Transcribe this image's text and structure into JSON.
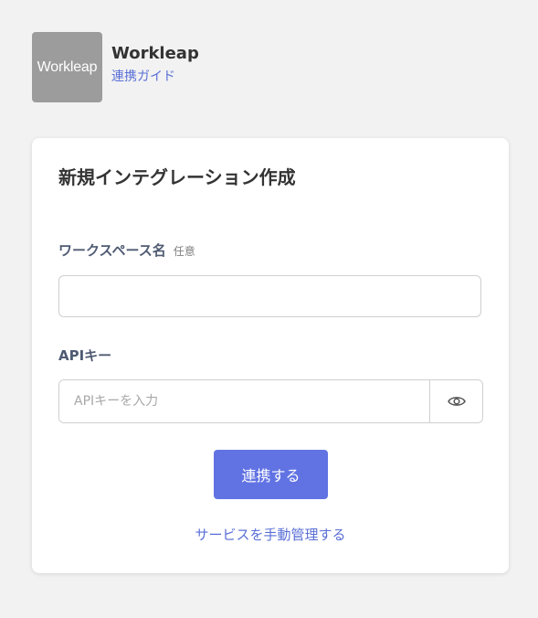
{
  "header": {
    "logo_text": "Workleap",
    "app_name": "Workleap",
    "guide_link": "連携ガイド"
  },
  "card": {
    "title": "新規インテグレーション作成",
    "workspace": {
      "label": "ワークスペース名",
      "optional_badge": "任意",
      "value": ""
    },
    "api_key": {
      "label": "APIキー",
      "placeholder": "APIキーを入力",
      "value": ""
    },
    "submit_label": "連携する",
    "manual_link": "サービスを手動管理する"
  },
  "icons": {
    "visibility_toggle": "eye-icon"
  },
  "colors": {
    "primary_button": "#6173e3",
    "link": "#5a6fd6",
    "logo_background": "#9c9c9c",
    "page_background": "#f2f2f2"
  }
}
